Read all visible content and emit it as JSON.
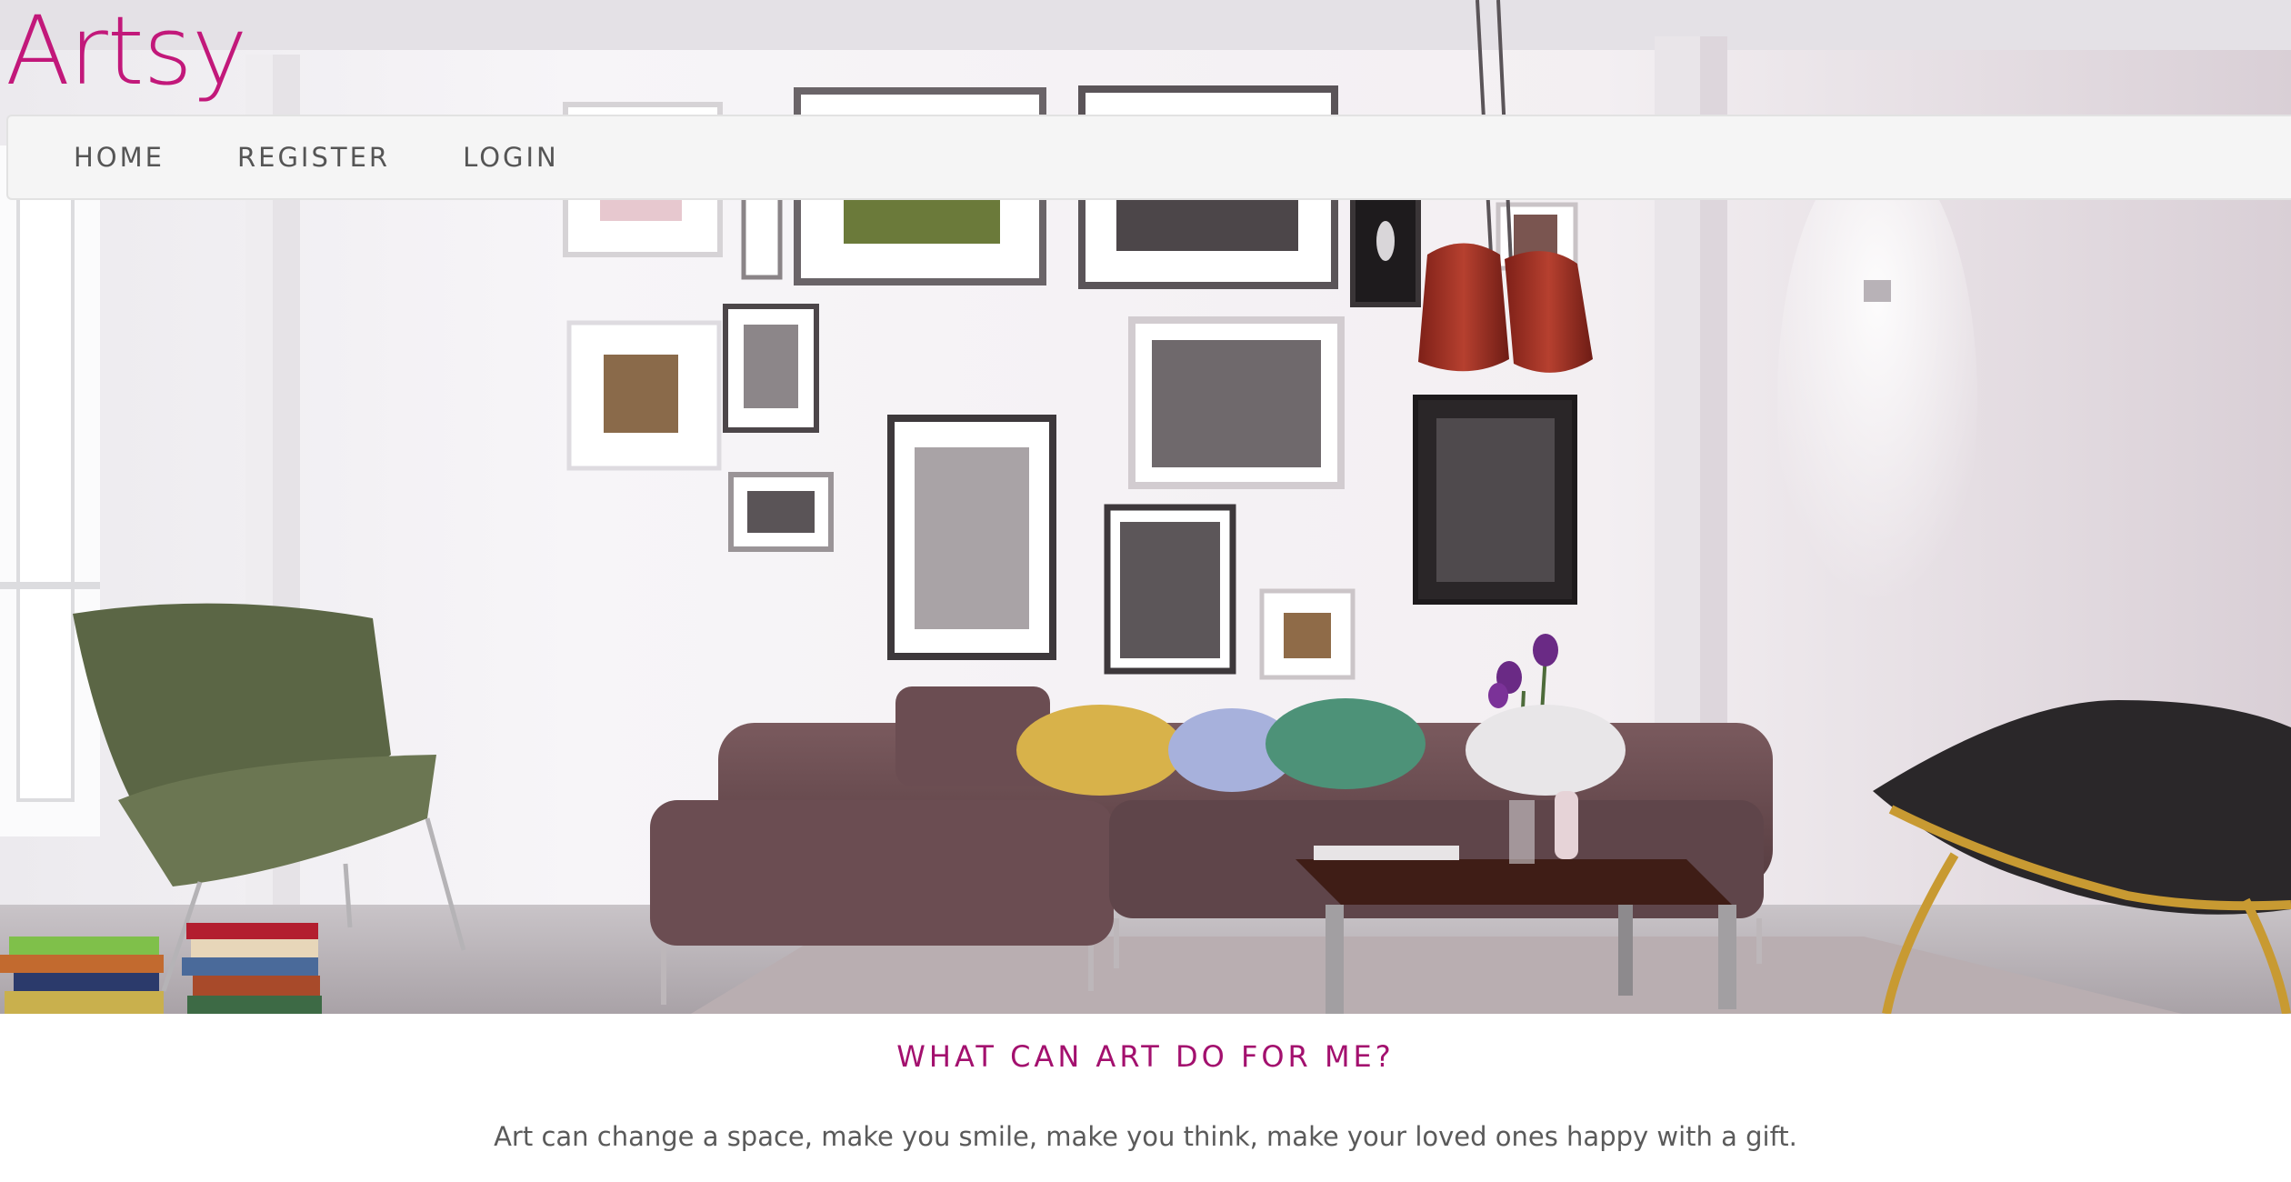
{
  "brand": {
    "name": "Artsy",
    "color": "#c2187a"
  },
  "nav": {
    "items": [
      {
        "label": "HOME"
      },
      {
        "label": "REGISTER"
      },
      {
        "label": "LOGIN"
      }
    ]
  },
  "hero": {
    "image": "living-room-with-gallery-wall"
  },
  "section": {
    "heading": "WHAT CAN ART DO FOR ME?",
    "body": "Art can change a space, make you smile, make you think, make your loved ones happy with a gift.",
    "heading_color": "#a3106e"
  }
}
